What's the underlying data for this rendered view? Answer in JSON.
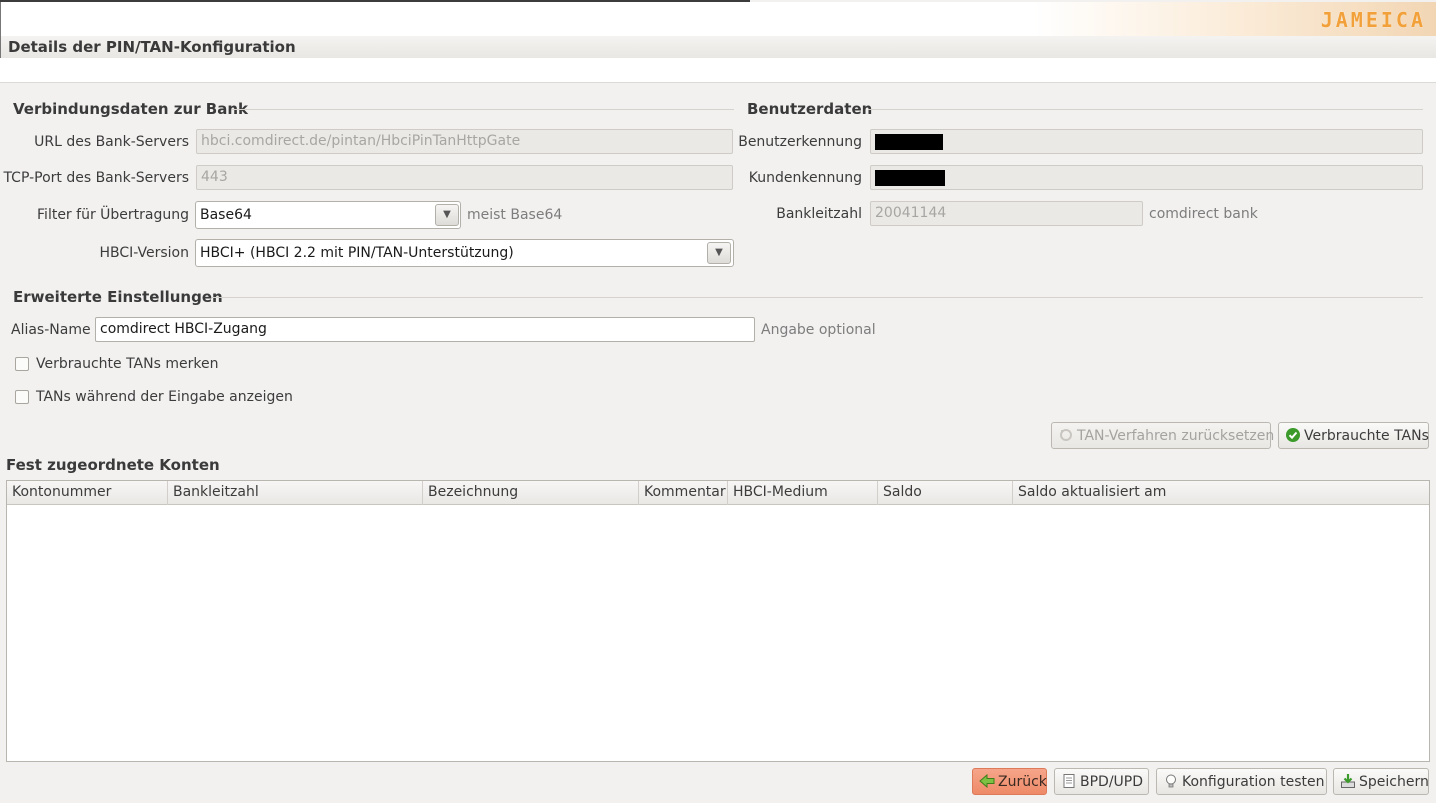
{
  "header": {
    "logo": "JAMEICA",
    "title": "Details der PIN/TAN-Konfiguration"
  },
  "bank": {
    "title": "Verbindungsdaten zur Bank",
    "url_label": "URL des Bank-Servers",
    "url_value": "hbci.comdirect.de/pintan/HbciPinTanHttpGate",
    "port_label": "TCP-Port des Bank-Servers",
    "port_value": "443",
    "filter_label": "Filter für Übertragung",
    "filter_value": "Base64",
    "filter_hint": "meist Base64",
    "version_label": "HBCI-Version",
    "version_value": "HBCI+ (HBCI 2.2 mit PIN/TAN-Unterstützung)"
  },
  "user": {
    "title": "Benutzerdaten",
    "userid_label": "Benutzerkennung",
    "customer_label": "Kundenkennung",
    "blz_label": "Bankleitzahl",
    "blz_value": "20041144",
    "blz_hint": "comdirect bank"
  },
  "advanced": {
    "title": "Erweiterte Einstellungen",
    "alias_label": "Alias-Name",
    "alias_value": "comdirect HBCI-Zugang",
    "alias_hint": "Angabe optional",
    "check_used_tans": "Verbrauchte TANs merken",
    "check_show_tans": "TANs während der Eingabe anzeigen",
    "checked_used_tans": false,
    "checked_show_tans": false
  },
  "actions": {
    "reset_tan": "TAN-Verfahren zurücksetzen",
    "used_tans": "Verbrauchte TANs"
  },
  "accounts": {
    "title": "Fest zugeordnete Konten",
    "columns": [
      "Kontonummer",
      "Bankleitzahl",
      "Bezeichnung",
      "Kommentar",
      "HBCI-Medium",
      "Saldo",
      "Saldo aktualisiert am"
    ],
    "rows": []
  },
  "footer": {
    "back": "Zurück",
    "bpd": "BPD/UPD",
    "test": "Konfiguration testen",
    "save": "Speichern"
  },
  "colors": {
    "accent": "#f2a13a",
    "primary_button": "#ee8a68"
  }
}
